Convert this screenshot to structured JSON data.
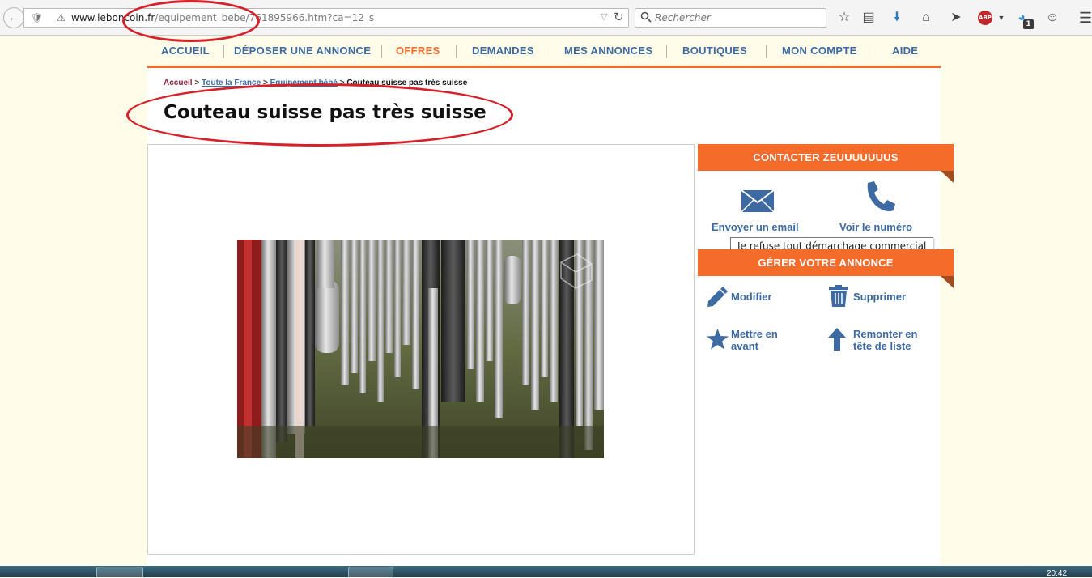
{
  "browser": {
    "url_domain": "www.leboncoin.fr",
    "url_path": "/equipement_bebe/761895966.htm?ca=12_s",
    "search_placeholder": "Rechercher",
    "notification_count": "1",
    "abp_label": "ABP"
  },
  "nav": {
    "items": [
      "ACCUEIL",
      "DÉPOSER UNE ANNONCE",
      "OFFRES",
      "DEMANDES",
      "MES ANNONCES",
      "BOUTIQUES",
      "MON COMPTE",
      "AIDE"
    ],
    "active": "OFFRES"
  },
  "breadcrumb": {
    "home": "Accueil",
    "separator": ">",
    "region": "Toute la France",
    "category": "Equipement bébé",
    "current": "Couteau suisse pas très suisse"
  },
  "listing": {
    "title": "Couteau suisse pas très suisse"
  },
  "contact": {
    "header": "CONTACTER ZEUUUUUUUS",
    "email_label": "Envoyer un email",
    "phone_label": "Voir le numéro",
    "tooltip": "Je refuse tout démarchage commercial"
  },
  "manage": {
    "header": "GÉRER VOTRE ANNONCE",
    "edit_label": "Modifier",
    "delete_label": "Supprimer",
    "feature_label_1": "Mettre en",
    "feature_label_2": "avant",
    "bump_label_1": "Remonter en",
    "bump_label_2": "tête de liste"
  },
  "taskbar": {
    "clock": "20:42"
  },
  "colors": {
    "accent": "#f56b2a",
    "link": "#3d6aa2",
    "annotation": "#d7212a",
    "page_bg": "#fffde9"
  }
}
